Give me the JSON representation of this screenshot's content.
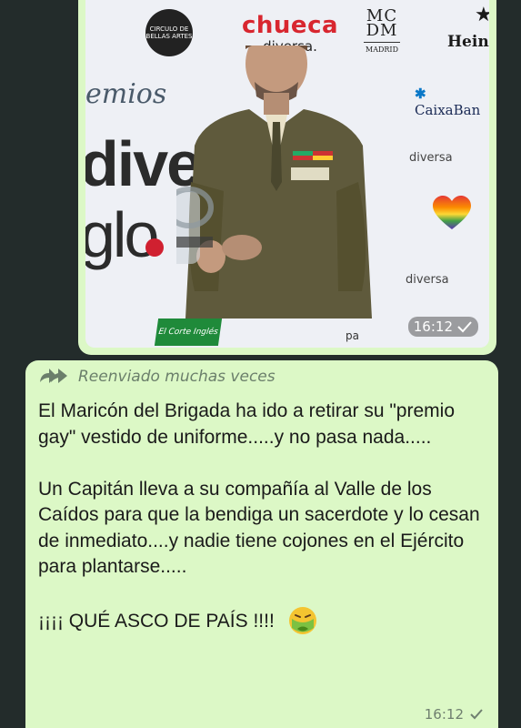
{
  "image_message": {
    "time": "16:12",
    "photo_text": {
      "circulo": "CIRCULO DE BELLAS ARTES",
      "chueca_top": "chueca",
      "chueca_bottom": "diversa.",
      "mcdm": "MC DM",
      "mcdm_city": "MADRID",
      "heineken": "Heine",
      "premios": "emios",
      "diver": "diver",
      "glob": "glo",
      "caixa": "CaixaBan",
      "diversa_1": "diversa",
      "diversa_2": "diversa",
      "corte": "El Corte Inglés",
      "pa": "pa"
    }
  },
  "text_message": {
    "forwarded_label": "Reenviado muchas veces",
    "paragraph_1": "El Maricón del Brigada ha ido a retirar su \"premio gay\" vestido de uniforme.....y no pasa nada.....",
    "paragraph_2": "Un Capitán lleva a su compañía al Valle de los Caídos para que la bendiga un sacerdote y lo cesan de inmediato....y nadie tiene cojones en el Ejército para plantarse.....",
    "paragraph_3": "¡¡¡¡ QUÉ ASCO DE PAÍS !!!!",
    "emoji": "nauseated-face",
    "time": "16:12"
  },
  "colors": {
    "chat_background": "#232c2b",
    "bubble_outgoing": "#dcf8c6"
  }
}
